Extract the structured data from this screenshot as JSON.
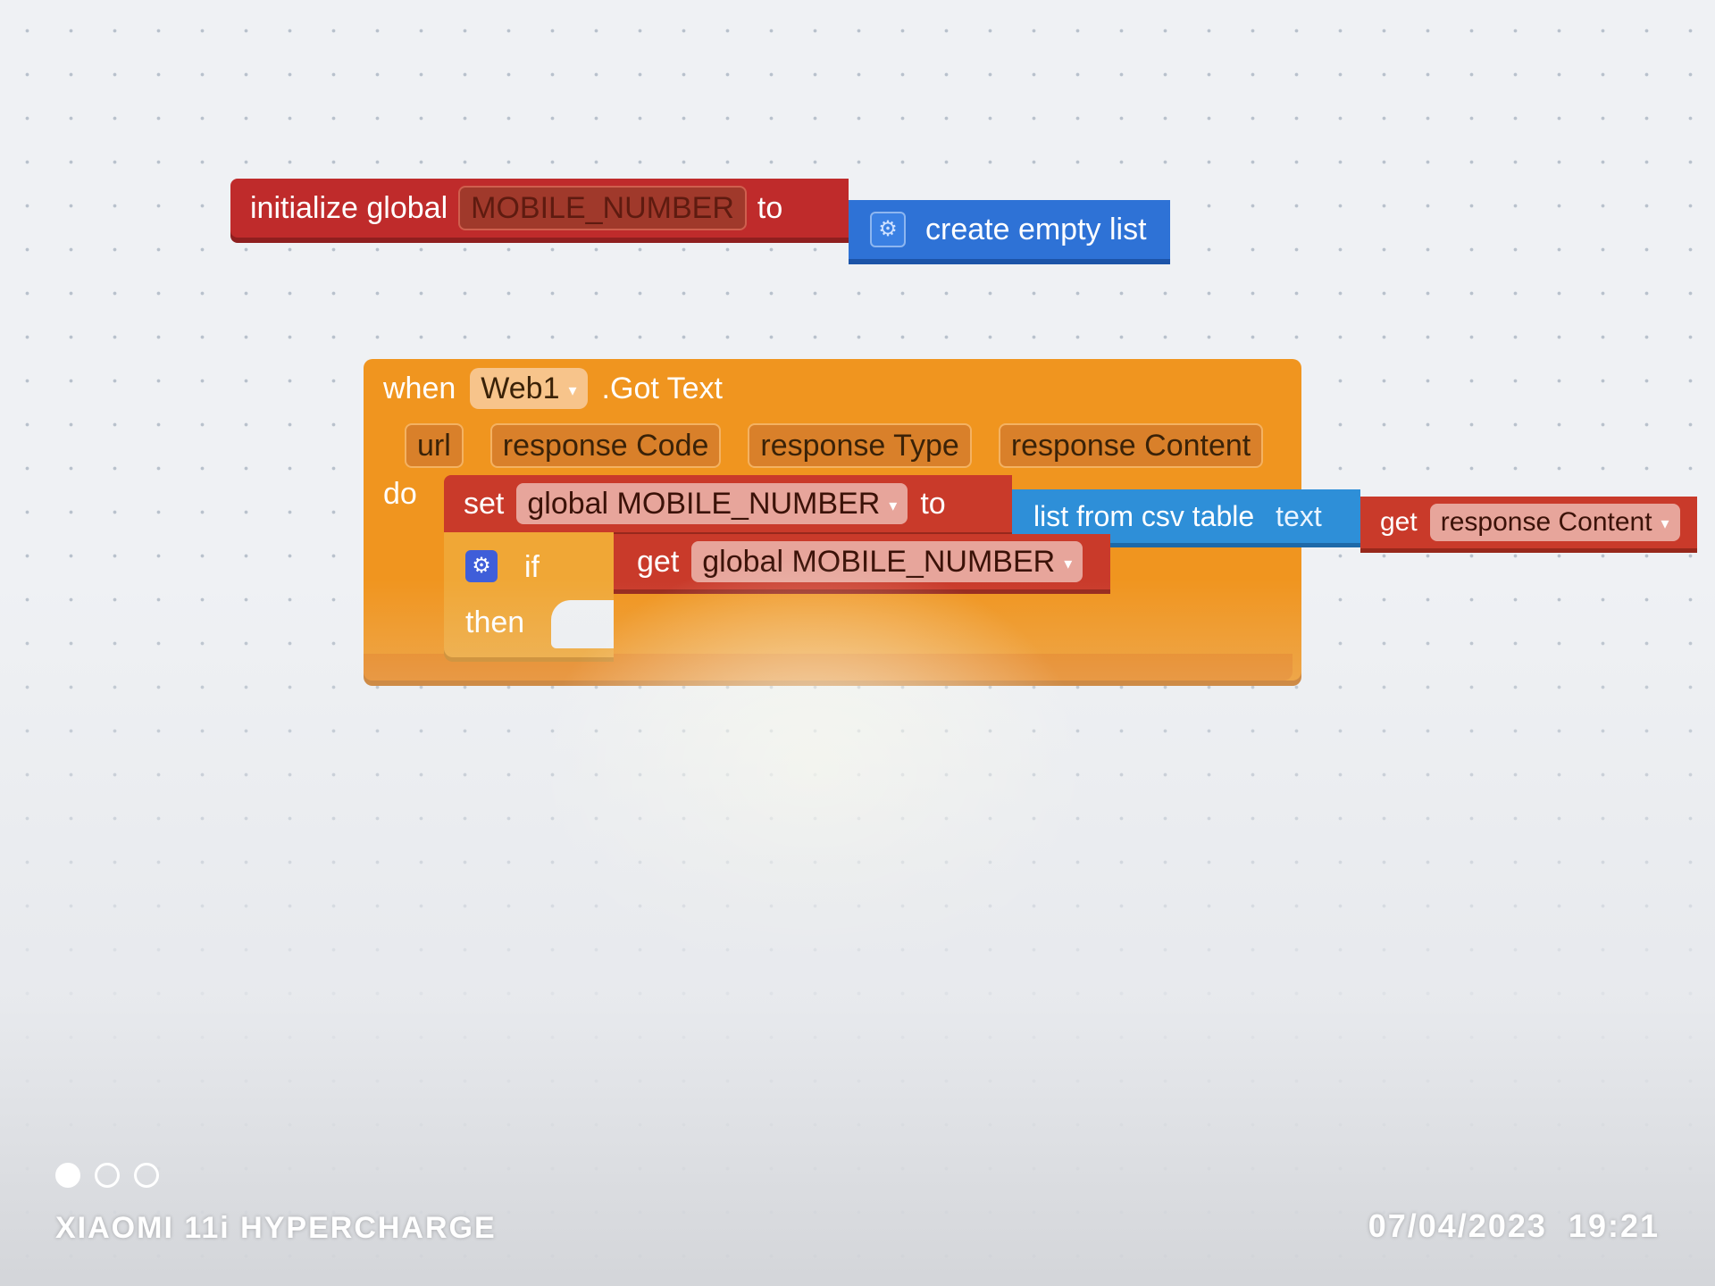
{
  "blocks": {
    "init": {
      "prefix": "initialize global",
      "var_name": "MOBILE_NUMBER",
      "to": "to",
      "value": "create empty list"
    },
    "event": {
      "when": "when",
      "component": "Web1",
      "event_name": ".Got Text",
      "params": [
        "url",
        "response Code",
        "response Type",
        "response Content"
      ],
      "do": "do"
    },
    "set": {
      "label": "set",
      "var_name": "global MOBILE_NUMBER",
      "to": "to",
      "csv_label": "list from csv table",
      "csv_param": "text",
      "get_label": "get",
      "get_var": "response Content"
    },
    "if": {
      "if_label": "if",
      "then_label": "then",
      "get_label": "get",
      "get_var": "global MOBILE_NUMBER"
    }
  },
  "watermark": {
    "device": "XIAOMI 11i HYPERCHARGE",
    "date": "07/04/2023",
    "time": "19:21"
  },
  "colors": {
    "variable_block": "#c93a2a",
    "list_block": "#2e72d6",
    "event_block": "#f0951f",
    "control_block": "#f0a736"
  },
  "icons": {
    "mutator": "gear-icon",
    "dropdown": "dropdown-arrow-icon"
  }
}
